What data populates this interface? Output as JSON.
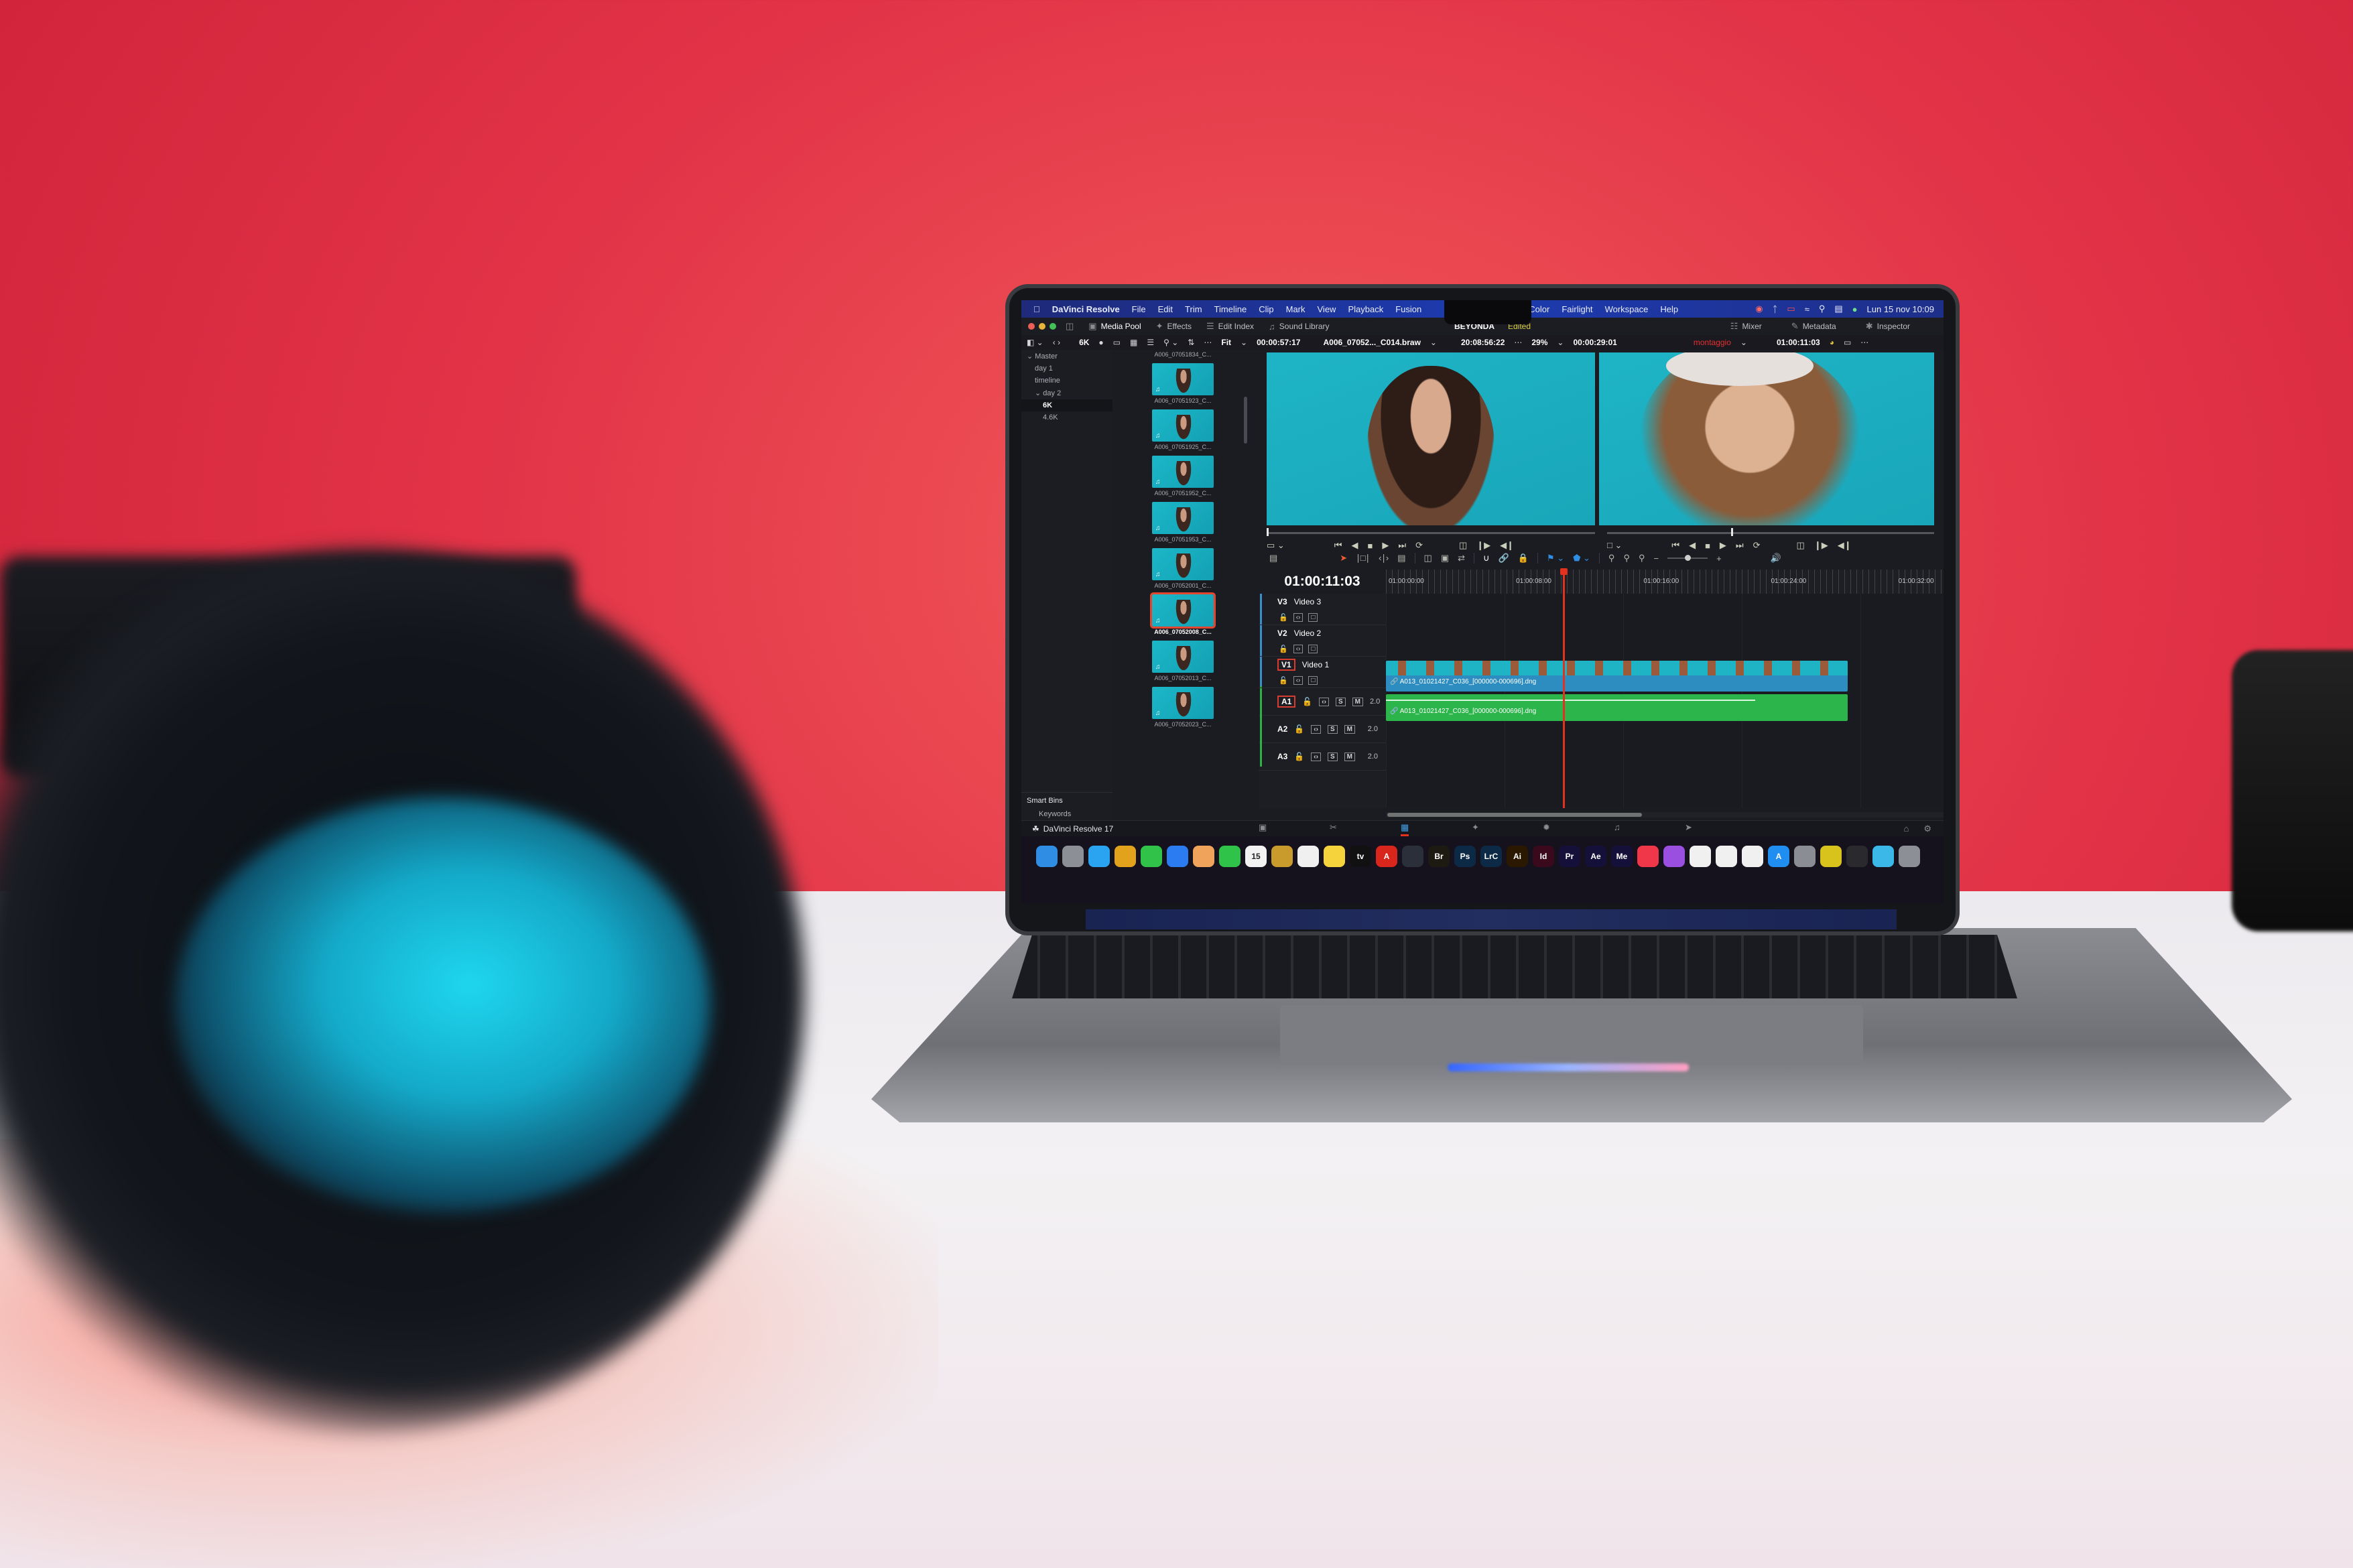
{
  "menubar": {
    "apple_icon": "apple-logo-icon",
    "app_name": "DaVinci Resolve",
    "items": [
      "File",
      "Edit",
      "Trim",
      "Timeline",
      "Clip",
      "Mark",
      "View",
      "Playback",
      "Fusion"
    ],
    "items_right": [
      "Color",
      "Fairlight",
      "Workspace",
      "Help"
    ],
    "status_icons": [
      "creative-cloud-icon",
      "bluetooth-icon",
      "battery-icon",
      "wifi-icon",
      "search-icon",
      "control-center-icon",
      "siri-icon"
    ],
    "clock": "Lun 15 nov  10:09"
  },
  "app_header": {
    "buttons": [
      {
        "label": "Media Pool",
        "icon": "media-pool-icon"
      },
      {
        "label": "Effects",
        "icon": "effects-icon"
      },
      {
        "label": "Edit Index",
        "icon": "edit-index-icon"
      },
      {
        "label": "Sound Library",
        "icon": "sound-library-icon"
      }
    ],
    "project_name": "BEYONDA",
    "project_status": "Edited",
    "right_buttons": [
      {
        "label": "Mixer",
        "icon": "mixer-icon"
      },
      {
        "label": "Metadata",
        "icon": "metadata-icon"
      },
      {
        "label": "Inspector",
        "icon": "inspector-icon"
      }
    ]
  },
  "toolbar": {
    "resolution": "6K",
    "viewer_fit": "Fit",
    "source_duration": "00:00:57:17",
    "source_clip": "A006_07052..._C014.braw",
    "source_timecode": "20:08:56:22",
    "zoom_percent": "29%",
    "timeline_duration": "00:00:29:01",
    "timeline_name": "montaggio",
    "timeline_timecode": "01:00:11:03"
  },
  "bins": {
    "tree": [
      {
        "label": "Master",
        "level": 0,
        "expanded": true
      },
      {
        "label": "day 1",
        "level": 1
      },
      {
        "label": "timeline",
        "level": 1
      },
      {
        "label": "day 2",
        "level": 1,
        "expanded": true
      },
      {
        "label": "6K",
        "level": 2,
        "selected": true
      },
      {
        "label": "4.6K",
        "level": 2
      }
    ],
    "smart_bins_title": "Smart Bins",
    "smart_bins": [
      "Keywords"
    ]
  },
  "media_pool": {
    "clips": [
      {
        "name": "A006_07051834_C..."
      },
      {
        "name": "A006_07051923_C..."
      },
      {
        "name": "A006_07051925_C..."
      },
      {
        "name": "A006_07051952_C..."
      },
      {
        "name": "A006_07051953_C..."
      },
      {
        "name": "A006_07052001_C..."
      },
      {
        "name": "A006_07052008_C...",
        "selected": true
      },
      {
        "name": "A006_07052013_C..."
      },
      {
        "name": "A006_07052023_C..."
      }
    ]
  },
  "viewers": {
    "source_playhead_fraction": 0.0,
    "timeline_playhead_fraction": 0.38
  },
  "timeline": {
    "current_timecode": "01:00:11:03",
    "ruler_ticks": [
      "01:00:00:00",
      "01:00:08:00",
      "01:00:16:00",
      "01:00:24:00",
      "01:00:32:00"
    ],
    "video_tracks": [
      {
        "id": "V3",
        "name": "Video 3"
      },
      {
        "id": "V2",
        "name": "Video 2"
      },
      {
        "id": "V1",
        "name": "Video 1",
        "selected": true
      }
    ],
    "audio_tracks": [
      {
        "id": "A1",
        "volume": "2.0",
        "selected": true
      },
      {
        "id": "A2",
        "volume": "2.0"
      },
      {
        "id": "A3",
        "volume": "2.0"
      }
    ],
    "solo_label": "S",
    "mute_label": "M",
    "video_clip_name": "A013_01021427_C036_[000000-000696].dng",
    "audio_clip_name": "A013_01021427_C036_[000000-000696].dng",
    "clip_start_seconds": 0,
    "clip_end_seconds": 29,
    "playhead_seconds": 11.1,
    "ruler_span_seconds": 35
  },
  "page_tabs": {
    "brand": "DaVinci Resolve 17",
    "tabs": [
      "media-page",
      "cut-page",
      "edit-page",
      "fusion-page",
      "color-page",
      "fairlight-page",
      "deliver-page"
    ],
    "active": "edit-page",
    "right": [
      "home-icon",
      "settings-icon"
    ]
  },
  "dock": {
    "apps": [
      {
        "name": "Finder",
        "label": "",
        "color": "#2f8de4"
      },
      {
        "name": "Launchpad",
        "label": "",
        "color": "#8c8f96"
      },
      {
        "name": "Safari",
        "label": "",
        "color": "#2aa3f0"
      },
      {
        "name": "Chrome",
        "label": "",
        "color": "#e2a21c"
      },
      {
        "name": "Messages",
        "label": "",
        "color": "#31c24a"
      },
      {
        "name": "Mail",
        "label": "",
        "color": "#2b7cf0"
      },
      {
        "name": "Photos",
        "label": "",
        "color": "#f0a35a"
      },
      {
        "name": "FaceTime",
        "label": "",
        "color": "#2fc34a"
      },
      {
        "name": "Calendar",
        "label": "15",
        "color": "#f2f2f2"
      },
      {
        "name": "Keynote-like",
        "label": "",
        "color": "#c99a2c"
      },
      {
        "name": "Reminders",
        "label": "",
        "color": "#f0f0f0"
      },
      {
        "name": "Notes",
        "label": "",
        "color": "#f4d33c"
      },
      {
        "name": "Apple TV",
        "label": "tv",
        "color": "#111111"
      },
      {
        "name": "Acrobat",
        "label": "A",
        "color": "#d8261c"
      },
      {
        "name": "DaVinci Resolve",
        "label": "",
        "color": "#2a2f3a"
      },
      {
        "name": "Bridge",
        "label": "Br",
        "color": "#1d1a12"
      },
      {
        "name": "Photoshop",
        "label": "Ps",
        "color": "#0c2a45"
      },
      {
        "name": "Lightroom Classic",
        "label": "LrC",
        "color": "#0c2a45"
      },
      {
        "name": "Illustrator",
        "label": "Ai",
        "color": "#2b1800"
      },
      {
        "name": "InDesign",
        "label": "Id",
        "color": "#3a0a1c"
      },
      {
        "name": "Premiere Pro",
        "label": "Pr",
        "color": "#15103a"
      },
      {
        "name": "After Effects",
        "label": "Ae",
        "color": "#15103a"
      },
      {
        "name": "Media Encoder",
        "label": "Me",
        "color": "#15103a"
      },
      {
        "name": "Music",
        "label": "",
        "color": "#f0374a"
      },
      {
        "name": "Podcasts",
        "label": "",
        "color": "#9a4fe0"
      },
      {
        "name": "Keynote",
        "label": "",
        "color": "#f0f0f0"
      },
      {
        "name": "Numbers",
        "label": "",
        "color": "#f0f0f0"
      },
      {
        "name": "Pages",
        "label": "",
        "color": "#f0f0f0"
      },
      {
        "name": "App Store",
        "label": "A",
        "color": "#1f8ef0"
      },
      {
        "name": "System Preferences",
        "label": "",
        "color": "#8a8d93"
      },
      {
        "name": "Final Cut-like",
        "label": "",
        "color": "#d8c31c"
      },
      {
        "name": "Terminal-like",
        "label": "",
        "color": "#2a2a2e"
      },
      {
        "name": "Downloads",
        "label": "",
        "color": "#3bb8e8"
      },
      {
        "name": "Trash",
        "label": "",
        "color": "#8c8f96"
      }
    ]
  },
  "colors": {
    "accent_red": "#e2321f",
    "video_clip": "#2d8dc0",
    "audio_clip": "#2bb54a",
    "edited_yellow": "#d9cd3a",
    "timeline_name_red": "#e53131"
  }
}
